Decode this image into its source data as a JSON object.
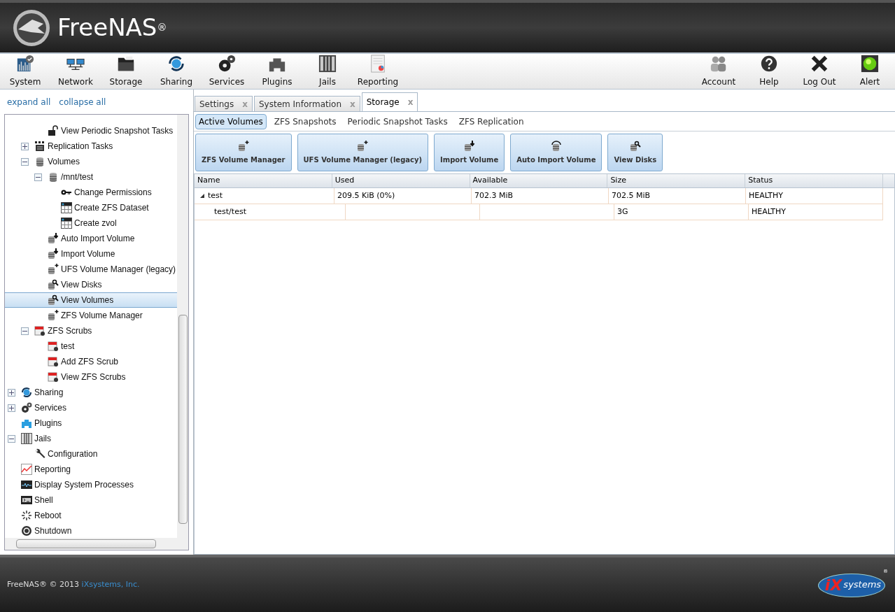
{
  "header": {
    "logo": "FreeNAS$^{®}$"
  },
  "nav": [
    {
      "label": "System",
      "kind": "system"
    },
    {
      "label": "Network",
      "kind": "network"
    },
    {
      "label": "Storage",
      "kind": "storage"
    },
    {
      "label": "Sharing",
      "kind": "sharing"
    },
    {
      "label": "Services",
      "kind": "services"
    },
    {
      "label": "Plugins",
      "kind": "plugins"
    },
    {
      "label": "Jails",
      "kind": "jails"
    },
    {
      "label": "Reporting",
      "kind": "reporting"
    }
  ],
  "nav_right": [
    {
      "label": "Account",
      "kind": "account"
    },
    {
      "label": "Help",
      "kind": "help"
    },
    {
      "label": "Log Out",
      "kind": "logout"
    },
    {
      "label": "Alert",
      "kind": "alert"
    }
  ],
  "sidebar": {
    "links": [
      "expand all",
      "collapse all"
    ],
    "tree": [
      {
        "children": [
          {
            "children": [
              {
                "label": "View Periodic Snapshot Tasks",
                "kind": "lock",
                "selected": false
              }
            ]
          },
          {
            "label": "Replication Tasks",
            "kind": "list",
            "expanded": false,
            "selected": false
          },
          {
            "label": "Volumes",
            "kind": "volume",
            "expanded": true,
            "selected": false,
            "children": [
              {
                "label": "/mnt/test",
                "kind": "volume",
                "expanded": true,
                "selected": false,
                "children": [
                  {
                    "label": "Change Permissions",
                    "kind": "key",
                    "selected": false
                  },
                  {
                    "label": "Create ZFS Dataset",
                    "kind": "grid",
                    "selected": false
                  },
                  {
                    "label": "Create zvol",
                    "kind": "grid",
                    "selected": false
                  }
                ]
              },
              {
                "label": "Auto Import Volume",
                "kind": "import",
                "selected": false
              },
              {
                "label": "Import Volume",
                "kind": "import",
                "selected": false
              },
              {
                "label": "UFS Volume Manager (legacy)",
                "kind": "add",
                "selected": false
              },
              {
                "label": "View Disks",
                "kind": "view",
                "selected": false
              },
              {
                "label": "View Volumes",
                "kind": "view",
                "selected": true
              },
              {
                "label": "ZFS Volume Manager",
                "kind": "add",
                "selected": false
              }
            ]
          },
          {
            "label": "ZFS Scrubs",
            "kind": "calendar",
            "expanded": true,
            "selected": false,
            "children": [
              {
                "label": "test",
                "kind": "calendar",
                "selected": false
              },
              {
                "label": "Add ZFS Scrub",
                "kind": "calendar",
                "selected": false
              },
              {
                "label": "View ZFS Scrubs",
                "kind": "calendar",
                "selected": false
              }
            ]
          }
        ]
      },
      {
        "label": "Sharing",
        "kind": "sharing",
        "expanded": false,
        "selected": false
      },
      {
        "label": "Services",
        "kind": "services",
        "expanded": false,
        "selected": false
      },
      {
        "label": "Plugins",
        "kind": "plugins",
        "selected": false
      },
      {
        "label": "Jails",
        "kind": "jails",
        "expanded": true,
        "selected": false,
        "children": [
          {
            "label": "Configuration",
            "kind": "wrench",
            "selected": false
          }
        ]
      },
      {
        "label": "Reporting",
        "kind": "chart",
        "selected": false
      },
      {
        "label": "Display System Processes",
        "kind": "monitor",
        "selected": false
      },
      {
        "label": "Shell",
        "kind": "terminal",
        "selected": false
      },
      {
        "label": "Reboot",
        "kind": "spinner",
        "selected": false
      },
      {
        "label": "Shutdown",
        "kind": "power",
        "selected": false
      }
    ]
  },
  "tabs": [
    {
      "label": "Settings",
      "close": "x",
      "selected": false
    },
    {
      "label": "System Information",
      "close": "x",
      "selected": false
    },
    {
      "label": "Storage",
      "close": "x",
      "selected": true
    }
  ],
  "subtabs": [
    {
      "label": "Active Volumes",
      "selected": true
    },
    {
      "label": "ZFS Snapshots",
      "selected": false
    },
    {
      "label": "Periodic Snapshot Tasks",
      "selected": false
    },
    {
      "label": "ZFS Replication",
      "selected": false
    }
  ],
  "actions": [
    {
      "label": "ZFS Volume Manager",
      "kind": "add"
    },
    {
      "label": "UFS Volume Manager (legacy)",
      "kind": "add"
    },
    {
      "label": "Import Volume",
      "kind": "import"
    },
    {
      "label": "Auto Import Volume",
      "kind": "auto"
    },
    {
      "label": "View Disks",
      "kind": "view"
    }
  ],
  "table": {
    "columns": [
      "Name",
      "Used",
      "Available",
      "Size",
      "Status"
    ],
    "rows": [
      {
        "cells": [
          "test",
          "209.5 KiB (0%)",
          "702.3 MiB",
          "702.5 MiB",
          "HEALTHY"
        ],
        "expanded": true,
        "child": false
      },
      {
        "cells": [
          "test/test",
          "",
          "",
          "3G",
          "HEALTHY"
        ],
        "child": true
      }
    ]
  },
  "footer": {
    "text": "FreeNAS® © 2013",
    "link": "iXsystems, Inc.",
    "logo_mark": "iX",
    "logo_text": "systems",
    "logo_reg": "®"
  }
}
